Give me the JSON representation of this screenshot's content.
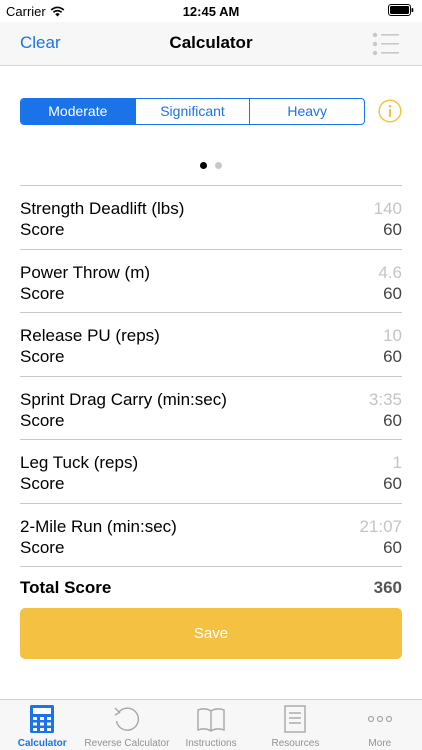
{
  "status": {
    "carrier": "Carrier",
    "time": "12:45 AM"
  },
  "nav": {
    "left_button": "Clear",
    "title": "Calculator"
  },
  "segments": [
    {
      "label": "Moderate",
      "selected": true
    },
    {
      "label": "Significant",
      "selected": false
    },
    {
      "label": "Heavy",
      "selected": false
    }
  ],
  "pager": {
    "pages": 2,
    "current": 1
  },
  "events": [
    {
      "name": "Strength Deadlift (lbs)",
      "value": "140",
      "score_label": "Score",
      "score": "60"
    },
    {
      "name": "Power Throw (m)",
      "value": "4.6",
      "score_label": "Score",
      "score": "60"
    },
    {
      "name": "Release PU (reps)",
      "value": "10",
      "score_label": "Score",
      "score": "60"
    },
    {
      "name": "Sprint Drag Carry (min:sec)",
      "value": "3:35",
      "score_label": "Score",
      "score": "60"
    },
    {
      "name": "Leg Tuck (reps)",
      "value": "1",
      "score_label": "Score",
      "score": "60"
    },
    {
      "name": "2-Mile Run (min:sec)",
      "value": "21:07",
      "score_label": "Score",
      "score": "60"
    }
  ],
  "total": {
    "label": "Total Score",
    "value": "360"
  },
  "save_button": "Save",
  "tabs": [
    {
      "label": "Calculator",
      "icon": "calculator-icon",
      "active": true
    },
    {
      "label": "Reverse Calculator",
      "icon": "reverse-icon",
      "active": false
    },
    {
      "label": "Instructions",
      "icon": "book-icon",
      "active": false
    },
    {
      "label": "Resources",
      "icon": "document-icon",
      "active": false
    },
    {
      "label": "More",
      "icon": "more-icon",
      "active": false
    }
  ],
  "colors": {
    "accent": "#1a73e8",
    "save": "#f4c143",
    "info": "#f4c143"
  }
}
